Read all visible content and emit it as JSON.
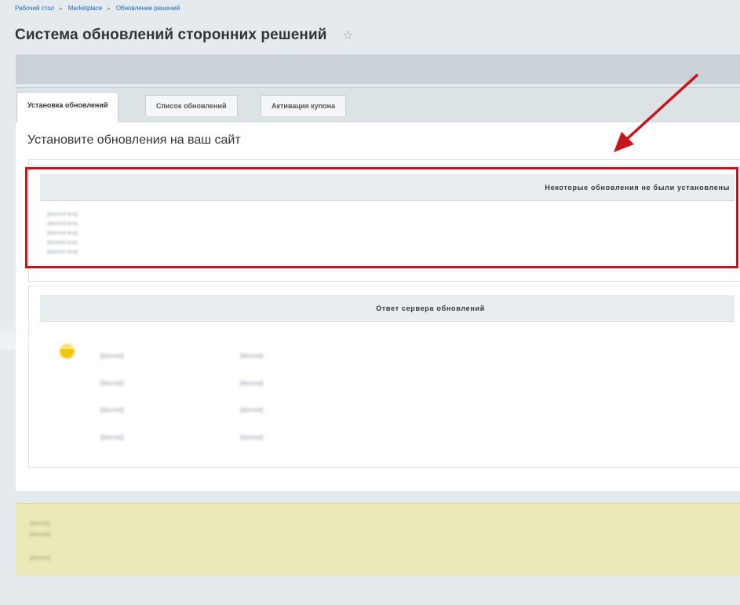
{
  "breadcrumbs": [
    "Рабочий стол",
    "Marketplace",
    "Обновление решений"
  ],
  "page_title": "Система обновлений сторонних решений",
  "star_icon": "star-outline-icon",
  "tabs": [
    {
      "label": "Установка обновлений",
      "active": true
    },
    {
      "label": "Список обновлений",
      "active": false
    },
    {
      "label": "Активация купона",
      "active": false
    }
  ],
  "subtitle": "Установите обновления на ваш сайт",
  "failed_updates": {
    "heading": "Некоторые обновления не были установлены",
    "details": [
      "[blurred text]",
      "[blurred text]",
      "[blurred text]",
      "[blurred text]",
      "[blurred text]"
    ]
  },
  "server_response": {
    "heading": "Ответ сервера обновлений",
    "status_icon": "status-dot-icon",
    "status_color": "#f2c600",
    "rows": [
      {
        "label": "[blurred]",
        "value": "[blurred]"
      },
      {
        "label": "[blurred]",
        "value": "[blurred]"
      },
      {
        "label": "[blurred]",
        "value": "[blurred]"
      },
      {
        "label": "[blurred]",
        "value": "[blurred]"
      }
    ]
  },
  "notice": {
    "lines": [
      "[blurred]",
      "[blurred]",
      "[blurred]"
    ]
  },
  "annotation": {
    "color": "#c8151b",
    "icon": "arrow-annotation-icon"
  }
}
